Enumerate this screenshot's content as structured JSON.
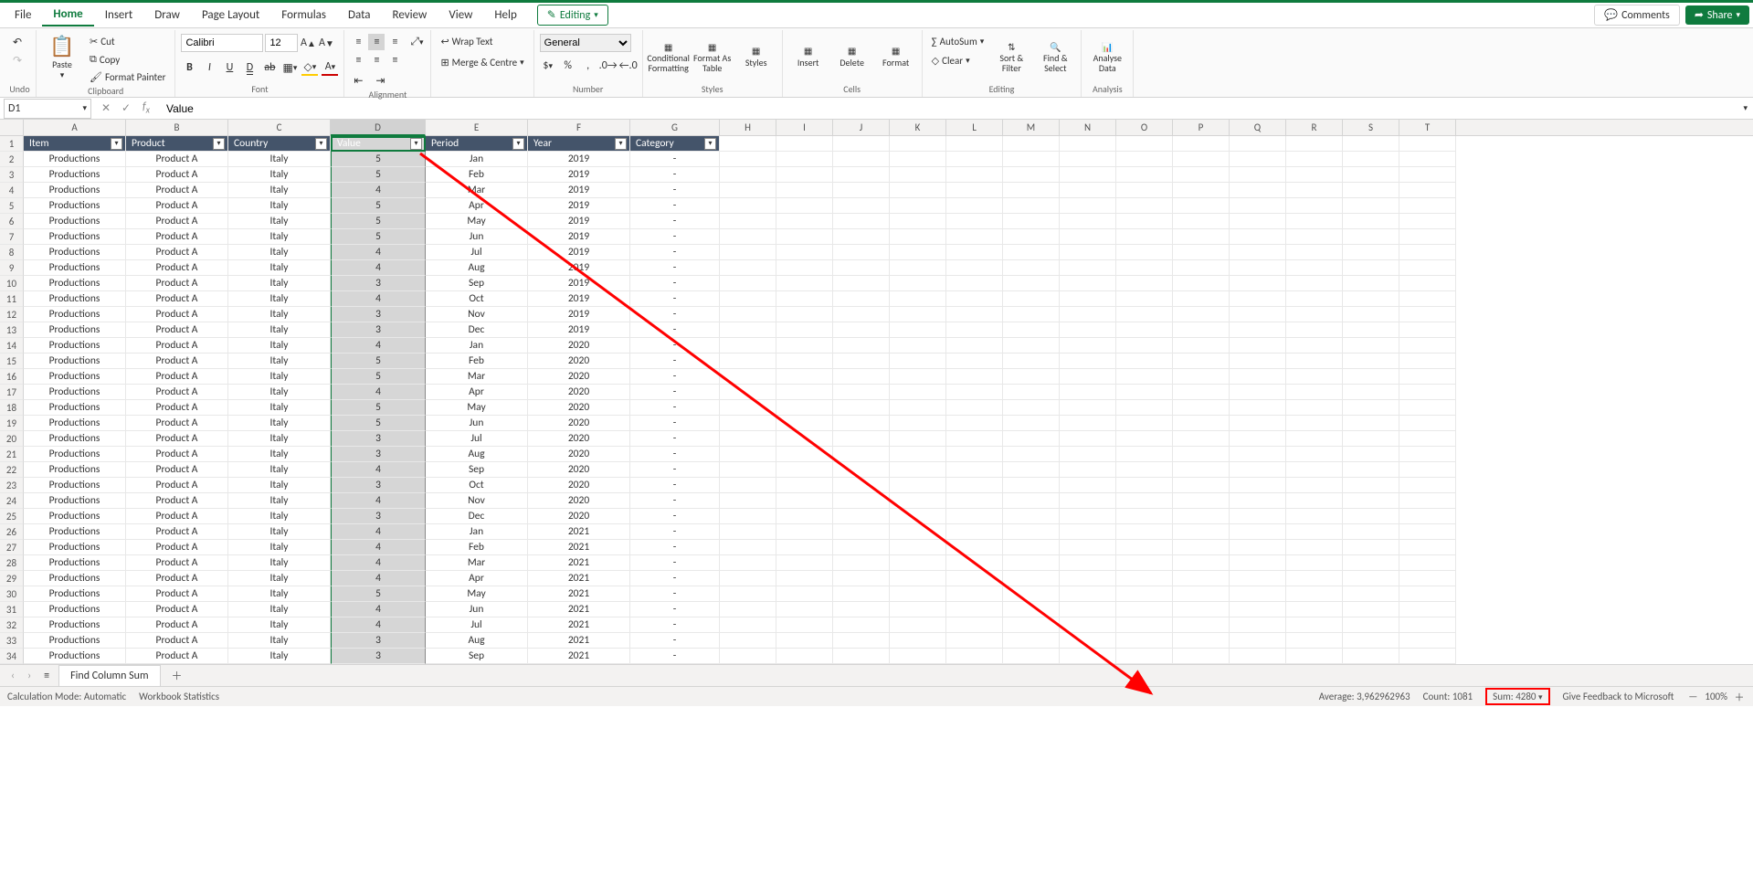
{
  "tabs": {
    "file": "File",
    "home": "Home",
    "insert": "Insert",
    "draw": "Draw",
    "pagelayout": "Page Layout",
    "formulas": "Formulas",
    "data": "Data",
    "review": "Review",
    "view": "View",
    "help": "Help"
  },
  "toolbar": {
    "editing": "Editing",
    "comments": "Comments",
    "share": "Share"
  },
  "ribbon": {
    "undo": "Undo",
    "paste": "Paste",
    "cut": "Cut",
    "copy": "Copy",
    "format_painter": "Format Painter",
    "clipboard": "Clipboard",
    "font_name": "Calibri",
    "font_size": "12",
    "font_group": "Font",
    "wrap_text": "Wrap Text",
    "merge_centre": "Merge & Centre",
    "alignment": "Alignment",
    "number_format": "General",
    "number_group": "Number",
    "conditional": "Conditional Formatting",
    "format_as_table": "Format As Table",
    "styles": "Styles",
    "styles_group": "Styles",
    "insert": "Insert",
    "delete": "Delete",
    "format": "Format",
    "cells_group": "Cells",
    "autosum": "AutoSum",
    "clear": "Clear",
    "sort_filter": "Sort & Filter",
    "find_select": "Find & Select",
    "editing_group": "Editing",
    "analyse_data": "Analyse Data",
    "analysis_group": "Analysis"
  },
  "formula_bar": {
    "name_box": "D1",
    "fx_value": "Value"
  },
  "columns": [
    "A",
    "B",
    "C",
    "D",
    "E",
    "F",
    "G",
    "H",
    "I",
    "J",
    "K",
    "L",
    "M",
    "N",
    "O",
    "P",
    "Q",
    "R",
    "S",
    "T"
  ],
  "col_widths": {
    "std": 62,
    "D": 104,
    "G": 98,
    "A": 112,
    "B": 112,
    "C": 112,
    "E": 112,
    "F": 112
  },
  "headers": {
    "item": "Item",
    "product": "Product",
    "country": "Country",
    "value": "Value",
    "period": "Period",
    "year": "Year",
    "category": "Category"
  },
  "rows": [
    {
      "n": 1,
      "item": "Item",
      "product": "Product",
      "country": "Country",
      "value": "Value",
      "period": "Period",
      "year": "Year",
      "category": "Category",
      "header": true
    },
    {
      "n": 2,
      "item": "Productions",
      "product": "Product A",
      "country": "Italy",
      "value": "5",
      "period": "Jan",
      "year": "2019",
      "category": "-"
    },
    {
      "n": 3,
      "item": "Productions",
      "product": "Product A",
      "country": "Italy",
      "value": "5",
      "period": "Feb",
      "year": "2019",
      "category": "-"
    },
    {
      "n": 4,
      "item": "Productions",
      "product": "Product A",
      "country": "Italy",
      "value": "4",
      "period": "Mar",
      "year": "2019",
      "category": "-"
    },
    {
      "n": 5,
      "item": "Productions",
      "product": "Product A",
      "country": "Italy",
      "value": "5",
      "period": "Apr",
      "year": "2019",
      "category": "-"
    },
    {
      "n": 6,
      "item": "Productions",
      "product": "Product A",
      "country": "Italy",
      "value": "5",
      "period": "May",
      "year": "2019",
      "category": "-"
    },
    {
      "n": 7,
      "item": "Productions",
      "product": "Product A",
      "country": "Italy",
      "value": "5",
      "period": "Jun",
      "year": "2019",
      "category": "-"
    },
    {
      "n": 8,
      "item": "Productions",
      "product": "Product A",
      "country": "Italy",
      "value": "4",
      "period": "Jul",
      "year": "2019",
      "category": "-"
    },
    {
      "n": 9,
      "item": "Productions",
      "product": "Product A",
      "country": "Italy",
      "value": "4",
      "period": "Aug",
      "year": "2019",
      "category": "-"
    },
    {
      "n": 10,
      "item": "Productions",
      "product": "Product A",
      "country": "Italy",
      "value": "3",
      "period": "Sep",
      "year": "2019",
      "category": "-"
    },
    {
      "n": 11,
      "item": "Productions",
      "product": "Product A",
      "country": "Italy",
      "value": "4",
      "period": "Oct",
      "year": "2019",
      "category": "-"
    },
    {
      "n": 12,
      "item": "Productions",
      "product": "Product A",
      "country": "Italy",
      "value": "3",
      "period": "Nov",
      "year": "2019",
      "category": "-"
    },
    {
      "n": 13,
      "item": "Productions",
      "product": "Product A",
      "country": "Italy",
      "value": "3",
      "period": "Dec",
      "year": "2019",
      "category": "-"
    },
    {
      "n": 14,
      "item": "Productions",
      "product": "Product A",
      "country": "Italy",
      "value": "4",
      "period": "Jan",
      "year": "2020",
      "category": "-"
    },
    {
      "n": 15,
      "item": "Productions",
      "product": "Product A",
      "country": "Italy",
      "value": "5",
      "period": "Feb",
      "year": "2020",
      "category": "-"
    },
    {
      "n": 16,
      "item": "Productions",
      "product": "Product A",
      "country": "Italy",
      "value": "5",
      "period": "Mar",
      "year": "2020",
      "category": "-"
    },
    {
      "n": 17,
      "item": "Productions",
      "product": "Product A",
      "country": "Italy",
      "value": "4",
      "period": "Apr",
      "year": "2020",
      "category": "-"
    },
    {
      "n": 18,
      "item": "Productions",
      "product": "Product A",
      "country": "Italy",
      "value": "5",
      "period": "May",
      "year": "2020",
      "category": "-"
    },
    {
      "n": 19,
      "item": "Productions",
      "product": "Product A",
      "country": "Italy",
      "value": "5",
      "period": "Jun",
      "year": "2020",
      "category": "-"
    },
    {
      "n": 20,
      "item": "Productions",
      "product": "Product A",
      "country": "Italy",
      "value": "3",
      "period": "Jul",
      "year": "2020",
      "category": "-"
    },
    {
      "n": 21,
      "item": "Productions",
      "product": "Product A",
      "country": "Italy",
      "value": "3",
      "period": "Aug",
      "year": "2020",
      "category": "-"
    },
    {
      "n": 22,
      "item": "Productions",
      "product": "Product A",
      "country": "Italy",
      "value": "4",
      "period": "Sep",
      "year": "2020",
      "category": "-"
    },
    {
      "n": 23,
      "item": "Productions",
      "product": "Product A",
      "country": "Italy",
      "value": "3",
      "period": "Oct",
      "year": "2020",
      "category": "-"
    },
    {
      "n": 24,
      "item": "Productions",
      "product": "Product A",
      "country": "Italy",
      "value": "4",
      "period": "Nov",
      "year": "2020",
      "category": "-"
    },
    {
      "n": 25,
      "item": "Productions",
      "product": "Product A",
      "country": "Italy",
      "value": "3",
      "period": "Dec",
      "year": "2020",
      "category": "-"
    },
    {
      "n": 26,
      "item": "Productions",
      "product": "Product A",
      "country": "Italy",
      "value": "4",
      "period": "Jan",
      "year": "2021",
      "category": "-"
    },
    {
      "n": 27,
      "item": "Productions",
      "product": "Product A",
      "country": "Italy",
      "value": "4",
      "period": "Feb",
      "year": "2021",
      "category": "-"
    },
    {
      "n": 28,
      "item": "Productions",
      "product": "Product A",
      "country": "Italy",
      "value": "4",
      "period": "Mar",
      "year": "2021",
      "category": "-"
    },
    {
      "n": 29,
      "item": "Productions",
      "product": "Product A",
      "country": "Italy",
      "value": "4",
      "period": "Apr",
      "year": "2021",
      "category": "-"
    },
    {
      "n": 30,
      "item": "Productions",
      "product": "Product A",
      "country": "Italy",
      "value": "5",
      "period": "May",
      "year": "2021",
      "category": "-"
    },
    {
      "n": 31,
      "item": "Productions",
      "product": "Product A",
      "country": "Italy",
      "value": "4",
      "period": "Jun",
      "year": "2021",
      "category": "-"
    },
    {
      "n": 32,
      "item": "Productions",
      "product": "Product A",
      "country": "Italy",
      "value": "4",
      "period": "Jul",
      "year": "2021",
      "category": "-"
    },
    {
      "n": 33,
      "item": "Productions",
      "product": "Product A",
      "country": "Italy",
      "value": "3",
      "period": "Aug",
      "year": "2021",
      "category": "-"
    },
    {
      "n": 34,
      "item": "Productions",
      "product": "Product A",
      "country": "Italy",
      "value": "3",
      "period": "Sep",
      "year": "2021",
      "category": "-"
    }
  ],
  "sheet_tab": "Find Column Sum",
  "status": {
    "calc_mode": "Calculation Mode: Automatic",
    "wb_stats": "Workbook Statistics",
    "average": "Average: 3,962962963",
    "count": "Count: 1081",
    "sum": "Sum: 4280",
    "feedback": "Give Feedback to Microsoft",
    "zoom": "100%"
  }
}
